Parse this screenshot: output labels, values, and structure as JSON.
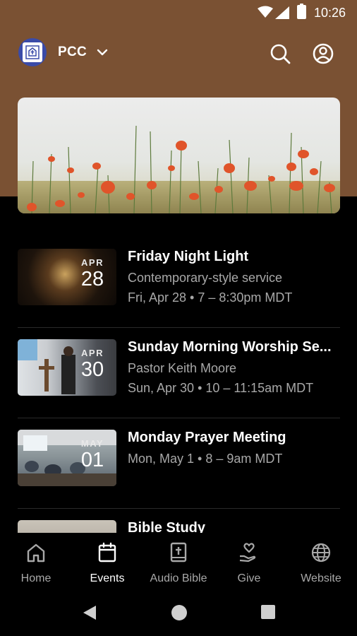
{
  "status_bar": {
    "time": "10:26"
  },
  "header": {
    "org_name": "PCC"
  },
  "events": [
    {
      "month": "APR",
      "day": "28",
      "title": "Friday Night Light",
      "subtitle": "Contemporary-style service",
      "meta": "Fri, Apr 28 • 7 – 8:30pm MDT"
    },
    {
      "month": "APR",
      "day": "30",
      "title": "Sunday Morning Worship Se...",
      "subtitle": "Pastor Keith Moore",
      "meta": "Sun, Apr 30 • 10 – 11:15am MDT"
    },
    {
      "month": "MAY",
      "day": "01",
      "title": "Monday Prayer Meeting",
      "subtitle": "",
      "meta": "Mon, May 1 • 8 – 9am MDT"
    },
    {
      "month": "",
      "day": "",
      "title": "Bible Study",
      "subtitle": "",
      "meta": ""
    }
  ],
  "nav": {
    "home": "Home",
    "events": "Events",
    "audio_bible": "Audio Bible",
    "give": "Give",
    "website": "Website"
  },
  "colors": {
    "header_brown": "#7a5133",
    "background": "#000000",
    "muted_text": "#a8a8a8"
  }
}
